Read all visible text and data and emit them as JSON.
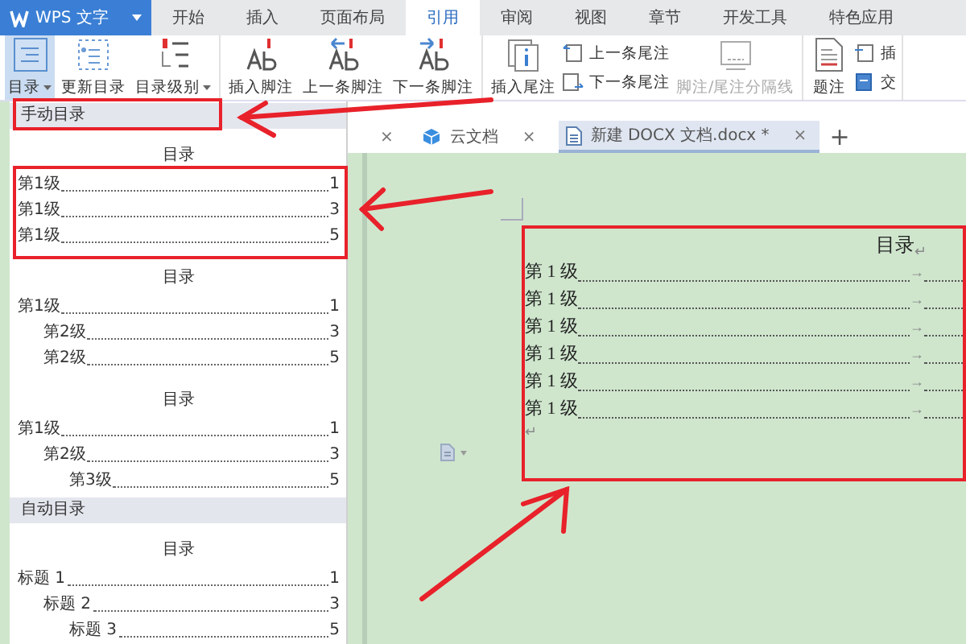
{
  "app": {
    "name": "WPS 文字"
  },
  "menu_tabs": [
    {
      "label": "开始",
      "selected": false
    },
    {
      "label": "插入",
      "selected": false
    },
    {
      "label": "页面布局",
      "selected": false
    },
    {
      "label": "引用",
      "selected": true
    },
    {
      "label": "审阅",
      "selected": false
    },
    {
      "label": "视图",
      "selected": false
    },
    {
      "label": "章节",
      "selected": false
    },
    {
      "label": "开发工具",
      "selected": false
    },
    {
      "label": "特色应用",
      "selected": false
    }
  ],
  "ribbon": {
    "groups": [
      {
        "items": [
          {
            "kind": "large",
            "label": "目录",
            "dropdown": true,
            "pressed": true,
            "disabled": false
          },
          {
            "kind": "large",
            "label": "更新目录",
            "dropdown": false,
            "pressed": false,
            "disabled": false
          },
          {
            "kind": "large",
            "label": "目录级别",
            "dropdown": true,
            "pressed": false,
            "disabled": false
          }
        ]
      },
      {
        "items": [
          {
            "kind": "large",
            "label": "插入脚注",
            "dropdown": false,
            "pressed": false,
            "disabled": false
          },
          {
            "kind": "large",
            "label": "上一条脚注",
            "dropdown": false,
            "pressed": false,
            "disabled": false
          },
          {
            "kind": "large",
            "label": "下一条脚注",
            "dropdown": false,
            "pressed": false,
            "disabled": false
          }
        ]
      },
      {
        "items": [
          {
            "kind": "large",
            "label": "插入尾注",
            "dropdown": false,
            "pressed": false,
            "disabled": false
          },
          {
            "kind": "stack",
            "items": [
              {
                "label": "上一条尾注",
                "disabled": false
              },
              {
                "label": "下一条尾注",
                "disabled": false
              }
            ]
          },
          {
            "kind": "large",
            "label": "脚注/尾注分隔线",
            "dropdown": false,
            "pressed": false,
            "disabled": true
          }
        ]
      },
      {
        "items": [
          {
            "kind": "large",
            "label": "题注",
            "dropdown": false,
            "pressed": false,
            "disabled": false
          },
          {
            "kind": "stack",
            "items": [
              {
                "label": "插",
                "disabled": false
              },
              {
                "label": "交",
                "disabled": false
              }
            ]
          }
        ]
      }
    ]
  },
  "toc_menu": {
    "sections": [
      {
        "title": "手动目录",
        "previews": [
          {
            "title": "目录",
            "entries": [
              {
                "text": "第1级",
                "page": "1"
              },
              {
                "text": "第1级",
                "page": "3"
              },
              {
                "text": "第1级",
                "page": "5"
              }
            ]
          },
          {
            "title": "目录",
            "entries": [
              {
                "text": "第1级",
                "page": "1",
                "children": [
                  {
                    "text": "第2级",
                    "page": "3"
                  },
                  {
                    "text": "第2级",
                    "page": "5"
                  }
                ]
              }
            ]
          },
          {
            "title": "目录",
            "entries": [
              {
                "text": "第1级",
                "page": "1",
                "children": [
                  {
                    "text": "第2级",
                    "page": "3",
                    "children": [
                      {
                        "text": "第3级",
                        "page": "5"
                      }
                    ]
                  }
                ]
              }
            ]
          }
        ]
      },
      {
        "title": "自动目录",
        "previews": [
          {
            "title": "目录",
            "entries": [
              {
                "text": "标题 1",
                "page": "1",
                "children": [
                  {
                    "text": "标题 2",
                    "page": "3",
                    "children": [
                      {
                        "text": "标题 3",
                        "page": "5"
                      }
                    ]
                  }
                ]
              }
            ]
          }
        ]
      }
    ]
  },
  "doc_tabs": [
    {
      "kind": "cut",
      "close": "×",
      "selected": false
    },
    {
      "kind": "cloud",
      "label": "云文档",
      "close": "×",
      "selected": false
    },
    {
      "kind": "document",
      "label": "新建 DOCX 文档.docx *",
      "close": "×",
      "selected": true
    }
  ],
  "new_tab": "+",
  "document": {
    "title": "目录",
    "title_mark": "↵",
    "entries": [
      {
        "text": "第 1 级",
        "tab_mark": "→"
      },
      {
        "text": "第 1 级",
        "tab_mark": "→"
      },
      {
        "text": "第 1 级",
        "tab_mark": "→"
      },
      {
        "text": "第 1 级",
        "tab_mark": "→"
      },
      {
        "text": "第 1 级",
        "tab_mark": "→"
      },
      {
        "text": "第 1 级",
        "tab_mark": "→"
      }
    ],
    "end_mark": "↵"
  }
}
